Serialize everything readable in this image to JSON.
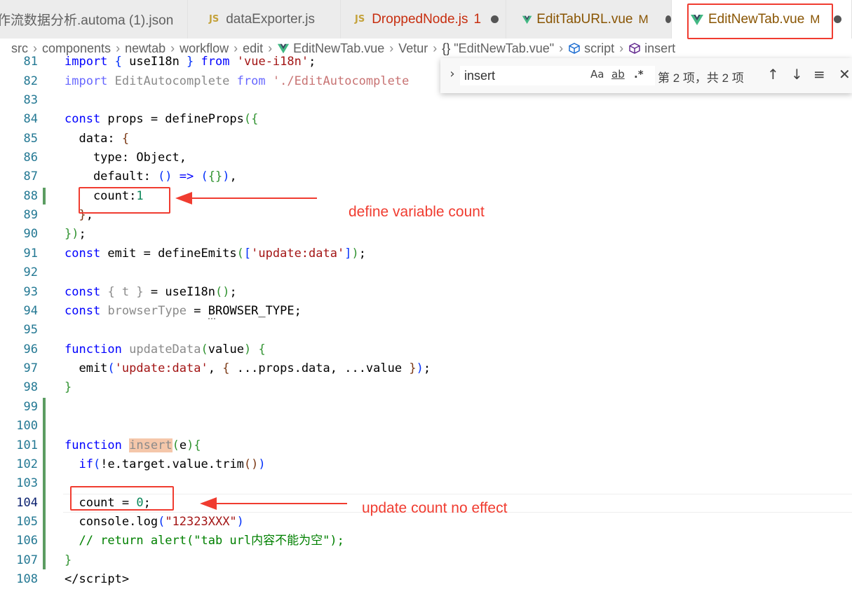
{
  "tabs": [
    {
      "label": "作流数据分析.automa (1).json",
      "kind": "json",
      "color": "#616161"
    },
    {
      "label": "dataExporter.js",
      "kind": "js",
      "color": "#616161",
      "icon": "JS"
    },
    {
      "label": "DroppedNode.js",
      "kind": "js",
      "color": "#c72e0f",
      "icon": "JS",
      "count": "1"
    },
    {
      "label": "EditTabURL.vue",
      "kind": "vue",
      "color": "#895503",
      "status": "M"
    },
    {
      "label": "EditNewTab.vue",
      "kind": "vue",
      "color": "#895503",
      "status": "M",
      "active": true
    }
  ],
  "breadcrumb": {
    "items": [
      "src",
      "components",
      "newtab",
      "workflow",
      "edit",
      "EditNewTab.vue",
      "Vetur",
      "\"EditNewTab.vue\"",
      "script",
      "insert"
    ],
    "icons": {
      "vue": "vue-logo-icon",
      "braces": "{}",
      "script": "cube-outline-icon",
      "insert": "method-cube-icon"
    }
  },
  "find": {
    "query": "insert",
    "match_case": "Aa",
    "whole_word": "ab",
    "regex": ".*",
    "result": "第 2 项，共 2 项",
    "prev_icon": "arrow-up-icon",
    "next_icon": "arrow-down-icon",
    "selection_icon": "find-in-selection-icon",
    "close_icon": "close-icon"
  },
  "code": {
    "line_numbers": [
      "81",
      "82",
      "83",
      "84",
      "85",
      "86",
      "87",
      "88",
      "89",
      "90",
      "91",
      "92",
      "93",
      "94",
      "95",
      "96",
      "97",
      "98",
      "99",
      "100",
      "101",
      "102",
      "103",
      "104",
      "105",
      "106",
      "107",
      "108"
    ],
    "current_line": "104"
  },
  "annotations": {
    "define": "define  variable  count",
    "update": "update count  no effect",
    "color": "#f03c30"
  },
  "colors": {
    "keyword": "#0000ff",
    "string": "#a31515",
    "number": "#098658",
    "comment": "#008000",
    "line_number": "#237893",
    "git_added": "#5c9d62"
  }
}
